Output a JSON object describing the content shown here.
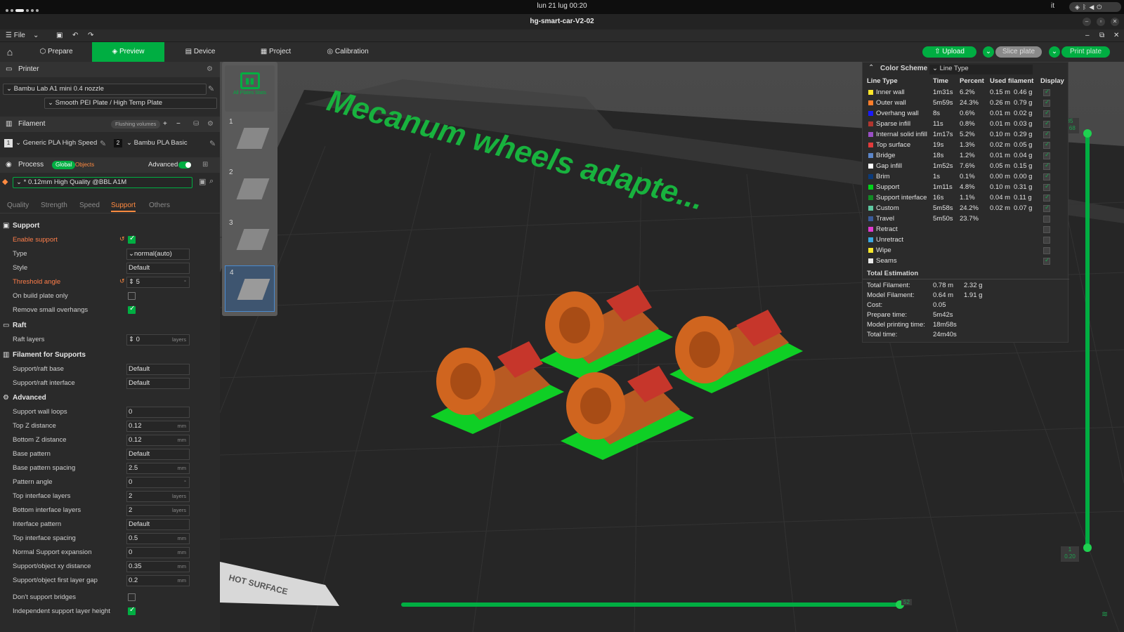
{
  "os": {
    "clock": "lun 21 lug  00:20",
    "lang": "it",
    "tray_icons": [
      "wifi-icon",
      "bluetooth-icon",
      "volume-icon",
      "power-icon"
    ]
  },
  "window": {
    "title": "hg-smart-car-V2-02"
  },
  "menubar": {
    "file_label": "File"
  },
  "tabs": [
    {
      "label": "Prepare",
      "icon": "cube-icon"
    },
    {
      "label": "Preview",
      "icon": "layers-icon"
    },
    {
      "label": "Device",
      "icon": "device-icon"
    },
    {
      "label": "Project",
      "icon": "project-icon"
    },
    {
      "label": "Calibration",
      "icon": "calibration-icon"
    }
  ],
  "actions": {
    "upload": "Upload",
    "slice": "Slice plate",
    "print": "Print plate"
  },
  "printer": {
    "section_label": "Printer",
    "name": "Bambu Lab A1 mini 0.4 nozzle",
    "plate": "Smooth PEI Plate / High Temp Plate"
  },
  "filament": {
    "section_label": "Filament",
    "flushing_label": "Flushing volumes",
    "items": [
      {
        "index": "1",
        "name": "Generic PLA High Speed"
      },
      {
        "index": "2",
        "name": "Bambu PLA Basic"
      }
    ]
  },
  "process": {
    "section_label": "Process",
    "global_label": "Global",
    "objects_label": "Objects",
    "advanced_label": "Advanced",
    "preset": "* 0.12mm High Quality @BBL A1M",
    "subtabs": [
      "Quality",
      "Strength",
      "Speed",
      "Support",
      "Others"
    ]
  },
  "support": {
    "group_label": "Support",
    "enable_support_label": "Enable support",
    "type_label": "Type",
    "type_value": "normal(auto)",
    "style_label": "Style",
    "style_value": "Default",
    "threshold_label": "Threshold angle",
    "threshold_value": "5",
    "threshold_unit": "°",
    "build_plate_only_label": "On build plate only",
    "remove_small_label": "Remove small overhangs"
  },
  "raft": {
    "group_label": "Raft",
    "raft_layers_label": "Raft layers",
    "raft_layers_value": "0",
    "raft_layers_unit": "layers"
  },
  "filament_supports": {
    "group_label": "Filament for Supports",
    "base_label": "Support/raft base",
    "base_value": "Default",
    "interface_label": "Support/raft interface",
    "interface_value": "Default"
  },
  "advanced": {
    "group_label": "Advanced",
    "rows": [
      {
        "label": "Support wall loops",
        "value": "0",
        "unit": ""
      },
      {
        "label": "Top Z distance",
        "value": "0.12",
        "unit": "mm"
      },
      {
        "label": "Bottom Z distance",
        "value": "0.12",
        "unit": "mm"
      },
      {
        "label": "Base pattern",
        "value": "Default",
        "unit": ""
      },
      {
        "label": "Base pattern spacing",
        "value": "2.5",
        "unit": "mm"
      },
      {
        "label": "Pattern angle",
        "value": "0",
        "unit": "°"
      },
      {
        "label": "Top interface layers",
        "value": "2",
        "unit": "layers"
      },
      {
        "label": "Bottom interface layers",
        "value": "2",
        "unit": "layers"
      },
      {
        "label": "Interface pattern",
        "value": "Default",
        "unit": ""
      },
      {
        "label": "Top interface spacing",
        "value": "0.5",
        "unit": "mm"
      },
      {
        "label": "Normal Support expansion",
        "value": "0",
        "unit": "mm"
      },
      {
        "label": "Support/object xy distance",
        "value": "0.35",
        "unit": "mm"
      },
      {
        "label": "Support/object first layer gap",
        "value": "0.2",
        "unit": "mm"
      }
    ],
    "dont_support_bridges_label": "Don't support bridges",
    "independent_layer_height_label": "Independent support layer height"
  },
  "plates": {
    "stats_label": "All Plates Stats",
    "items": [
      "1",
      "2",
      "3",
      "4"
    ]
  },
  "viewport": {
    "plate_text": "Mecanum wheels adapte...",
    "hot_surface": "HOT SURFACE",
    "vslider_top": "85",
    "vslider_top2": "9.68",
    "vslider_bottom": "1",
    "vslider_bottom2": "0.20",
    "hslider_value": "52"
  },
  "legend": {
    "title": "Color Scheme",
    "scheme": "Line Type",
    "headers": [
      "Line Type",
      "Time",
      "Percent",
      "Used filament",
      "Display"
    ],
    "rows": [
      {
        "name": "Inner wall",
        "color": "#ffe62a",
        "time": "1m31s",
        "percent": "6.2%",
        "m": "0.15 m",
        "g": "0.46 g",
        "display": true
      },
      {
        "name": "Outer wall",
        "color": "#ff7d2a",
        "time": "5m59s",
        "percent": "24.3%",
        "m": "0.26 m",
        "g": "0.79 g",
        "display": true
      },
      {
        "name": "Overhang wall",
        "color": "#1a1aff",
        "time": "8s",
        "percent": "0.6%",
        "m": "0.01 m",
        "g": "0.02 g",
        "display": true
      },
      {
        "name": "Sparse infill",
        "color": "#b0352e",
        "time": "11s",
        "percent": "0.8%",
        "m": "0.01 m",
        "g": "0.03 g",
        "display": true
      },
      {
        "name": "Internal solid infill",
        "color": "#9a4fc5",
        "time": "1m17s",
        "percent": "5.2%",
        "m": "0.10 m",
        "g": "0.29 g",
        "display": true
      },
      {
        "name": "Top surface",
        "color": "#e23a3a",
        "time": "19s",
        "percent": "1.3%",
        "m": "0.02 m",
        "g": "0.05 g",
        "display": true
      },
      {
        "name": "Bridge",
        "color": "#5c86c9",
        "time": "18s",
        "percent": "1.2%",
        "m": "0.01 m",
        "g": "0.04 g",
        "display": true
      },
      {
        "name": "Gap infill",
        "color": "#ffffff",
        "time": "1m52s",
        "percent": "7.6%",
        "m": "0.05 m",
        "g": "0.15 g",
        "display": true
      },
      {
        "name": "Brim",
        "color": "#0b3a7a",
        "time": "1s",
        "percent": "0.1%",
        "m": "0.00 m",
        "g": "0.00 g",
        "display": true
      },
      {
        "name": "Support",
        "color": "#00d21a",
        "time": "1m11s",
        "percent": "4.8%",
        "m": "0.10 m",
        "g": "0.31 g",
        "display": true
      },
      {
        "name": "Support interface",
        "color": "#128a25",
        "time": "16s",
        "percent": "1.1%",
        "m": "0.04 m",
        "g": "0.11 g",
        "display": true
      },
      {
        "name": "Custom",
        "color": "#5ec7a0",
        "time": "5m58s",
        "percent": "24.2%",
        "m": "0.02 m",
        "g": "0.07 g",
        "display": true
      },
      {
        "name": "Travel",
        "color": "#3a5b9a",
        "time": "5m50s",
        "percent": "23.7%",
        "m": "",
        "g": "",
        "display": false
      },
      {
        "name": "Retract",
        "color": "#e03ad0",
        "time": "",
        "percent": "",
        "m": "",
        "g": "",
        "display": false
      },
      {
        "name": "Unretract",
        "color": "#3aa8e0",
        "time": "",
        "percent": "",
        "m": "",
        "g": "",
        "display": false
      },
      {
        "name": "Wipe",
        "color": "#f5e62a",
        "time": "",
        "percent": "",
        "m": "",
        "g": "",
        "display": false
      },
      {
        "name": "Seams",
        "color": "#eaeaea",
        "time": "",
        "percent": "",
        "m": "",
        "g": "",
        "display": true
      }
    ],
    "total_title": "Total Estimation",
    "totals": [
      {
        "label": "Total Filament:",
        "a": "0.78 m",
        "b": "2.32 g"
      },
      {
        "label": "Model Filament:",
        "a": "0.64 m",
        "b": "1.91 g"
      },
      {
        "label": "Cost:",
        "a": "0.05",
        "b": ""
      },
      {
        "label": "Prepare time:",
        "a": "5m42s",
        "b": ""
      },
      {
        "label": "Model printing time:",
        "a": "18m58s",
        "b": ""
      },
      {
        "label": "Total time:",
        "a": "24m40s",
        "b": ""
      }
    ]
  },
  "colors": {
    "accent": "#00ae42",
    "highlight": "#ff7e4a"
  }
}
